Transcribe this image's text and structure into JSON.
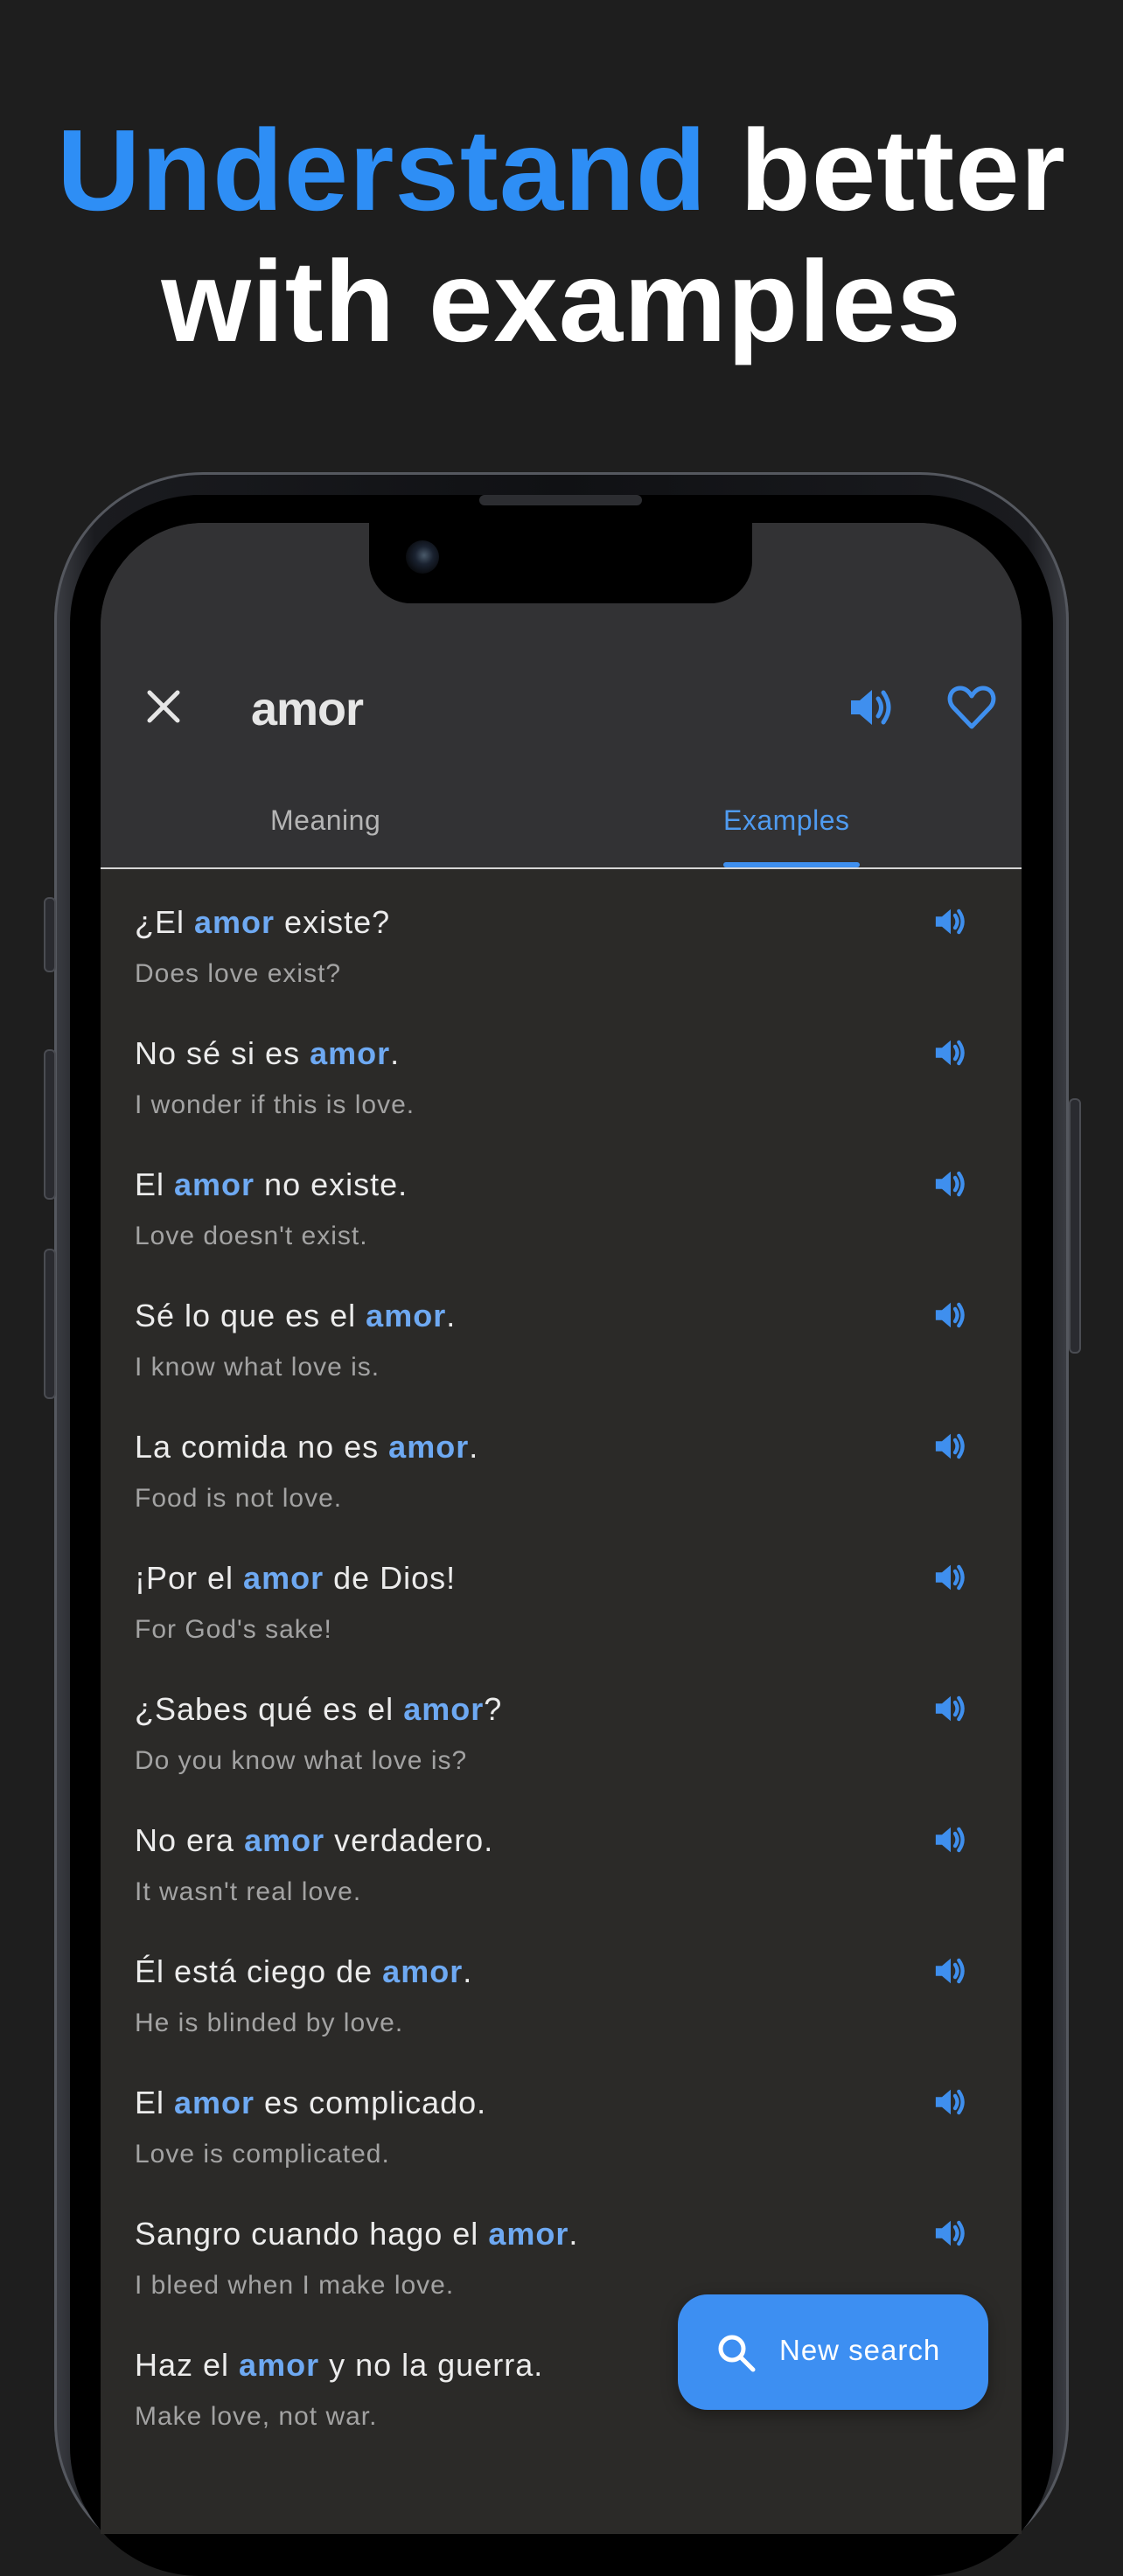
{
  "headline": {
    "accent_word": "Understand",
    "line1_rest": " better",
    "line2": "with examples"
  },
  "header": {
    "word": "amor",
    "speak_icon": "speaker-icon",
    "favorite_icon": "heart-icon",
    "close_icon": "close-icon"
  },
  "tabs": [
    {
      "label": "Meaning",
      "active": false
    },
    {
      "label": "Examples",
      "active": true
    }
  ],
  "examples": [
    {
      "before": "¿El ",
      "highlight": "amor",
      "after": " existe?",
      "translation": "Does love exist?"
    },
    {
      "before": "No sé si es ",
      "highlight": "amor",
      "after": ".",
      "translation": "I wonder if this is love."
    },
    {
      "before": "El ",
      "highlight": "amor",
      "after": " no existe.",
      "translation": "Love doesn't exist."
    },
    {
      "before": "Sé lo que es el ",
      "highlight": "amor",
      "after": ".",
      "translation": "I know what love is."
    },
    {
      "before": "La comida no es ",
      "highlight": "amor",
      "after": ".",
      "translation": "Food is not love."
    },
    {
      "before": "¡Por el ",
      "highlight": "amor",
      "after": " de Dios!",
      "translation": "For God's sake!"
    },
    {
      "before": "¿Sabes qué es el ",
      "highlight": "amor",
      "after": "?",
      "translation": "Do you know what love is?"
    },
    {
      "before": "No era ",
      "highlight": "amor",
      "after": " verdadero.",
      "translation": "It wasn't real love."
    },
    {
      "before": "Él está ciego de ",
      "highlight": "amor",
      "after": ".",
      "translation": "He is blinded by love."
    },
    {
      "before": "El ",
      "highlight": "amor",
      "after": " es complicado.",
      "translation": "Love is complicated."
    },
    {
      "before": "Sangro cuando hago el ",
      "highlight": "amor",
      "after": ".",
      "translation": "I bleed when I make love."
    },
    {
      "before": "Haz el ",
      "highlight": "amor",
      "after": " y no la guerra.",
      "translation": "Make love, not war."
    }
  ],
  "fab": {
    "label": "New search",
    "icon": "search-icon"
  },
  "colors": {
    "accent": "#2e8ef5",
    "highlight": "#6ea9f2",
    "background": "#1e1e1e",
    "screen": "#2b2a28"
  }
}
